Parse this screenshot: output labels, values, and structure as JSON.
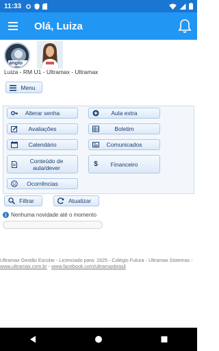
{
  "status": {
    "time": "11:33"
  },
  "header": {
    "title": "Olá, Luiza"
  },
  "profile": {
    "logo_text": "anglo",
    "user_info": "Luiza - RM U1 - Ultramax - Ultramax"
  },
  "menu_button": {
    "label": "Menu"
  },
  "actions": [
    {
      "label": "Alterar senha",
      "icon": "key-icon"
    },
    {
      "label": "Aula extra",
      "icon": "plus-circle-icon"
    },
    {
      "label": "Avaliações",
      "icon": "edit-icon"
    },
    {
      "label": "Boletim",
      "icon": "table-icon"
    },
    {
      "label": "Calendário",
      "icon": "calendar-icon"
    },
    {
      "label": "Comunicados",
      "icon": "newspaper-icon"
    },
    {
      "label": "Conteúdo de aula/dever",
      "icon": "file-icon"
    },
    {
      "label": "Financeiro",
      "icon": "dollar-icon"
    },
    {
      "label": "Ocorrências",
      "icon": "sad-face-icon"
    }
  ],
  "filter_button": {
    "label": "Filtrar"
  },
  "update_button": {
    "label": "Atualizar"
  },
  "news": {
    "text": "Nenhuma novidade até o momento"
  },
  "footer": {
    "line1": "Ultramax Gestão Escolar - Licenciado para: 1625 - Colégio Futura - Ultramax Sistemas -",
    "site": "www.ultramax.com.br",
    "sep": " - ",
    "facebook": "www.facebook.com/ultramaxbrasil"
  },
  "colors": {
    "statusbar": "#1976d2",
    "appbar": "#2196f3",
    "button_border": "#a9c7e8",
    "button_text": "#1b3d6e"
  }
}
